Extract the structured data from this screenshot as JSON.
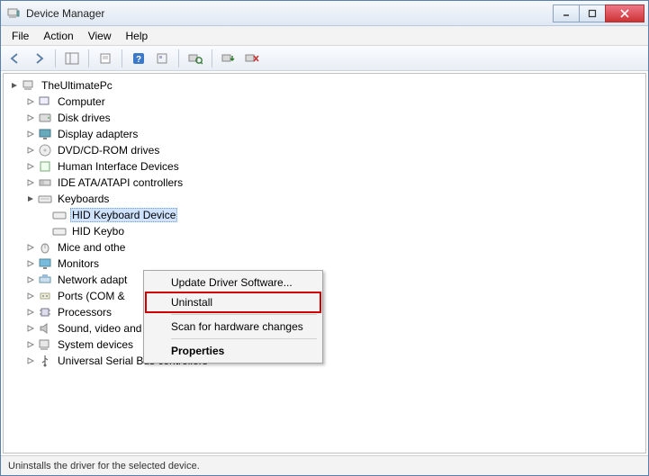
{
  "window": {
    "title": "Device Manager"
  },
  "menu": {
    "file": "File",
    "action": "Action",
    "view": "View",
    "help": "Help"
  },
  "tree": {
    "root": "TheUltimatePc",
    "nodes": [
      {
        "label": "Computer"
      },
      {
        "label": "Disk drives"
      },
      {
        "label": "Display adapters"
      },
      {
        "label": "DVD/CD-ROM drives"
      },
      {
        "label": "Human Interface Devices"
      },
      {
        "label": "IDE ATA/ATAPI controllers"
      },
      {
        "label": "Keyboards",
        "children": [
          {
            "label": "HID Keyboard Device"
          },
          {
            "label": "HID Keybo"
          }
        ]
      },
      {
        "label": "Mice and othe"
      },
      {
        "label": "Monitors"
      },
      {
        "label": "Network adapt"
      },
      {
        "label": "Ports (COM &"
      },
      {
        "label": "Processors"
      },
      {
        "label": "Sound, video and game controllers"
      },
      {
        "label": "System devices"
      },
      {
        "label": "Universal Serial Bus controllers"
      }
    ]
  },
  "context": {
    "update": "Update Driver Software...",
    "uninstall": "Uninstall",
    "scan": "Scan for hardware changes",
    "props": "Properties"
  },
  "status": "Uninstalls the driver for the selected device."
}
